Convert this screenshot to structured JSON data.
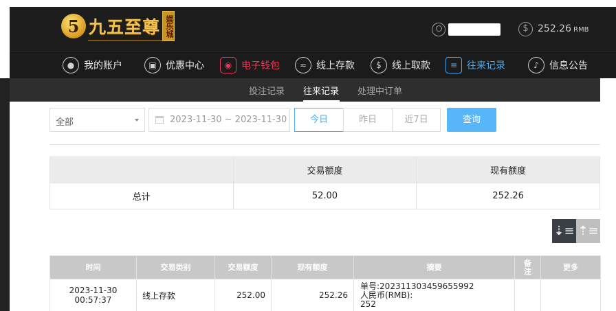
{
  "header": {
    "logo_mark": "5",
    "logo_text": "九五至尊",
    "logo_badge": "娱乐城",
    "balance_value": "252.26",
    "balance_unit": "RMB"
  },
  "nav": {
    "items": [
      {
        "label": "我的账户",
        "icon": "user-icon"
      },
      {
        "label": "优惠中心",
        "icon": "gift-icon"
      },
      {
        "label": "电子钱包",
        "icon": "wallet-icon"
      },
      {
        "label": "线上存款",
        "icon": "deposit-icon"
      },
      {
        "label": "线上取款",
        "icon": "withdraw-icon"
      },
      {
        "label": "往来记录",
        "icon": "records-icon"
      },
      {
        "label": "信息公告",
        "icon": "bell-icon"
      }
    ]
  },
  "subtabs": {
    "items": [
      {
        "label": "投注记录"
      },
      {
        "label": "往来记录"
      },
      {
        "label": "处理中订单"
      }
    ],
    "active": "往来记录"
  },
  "filters": {
    "type_select": "全部",
    "date_range": "2023-11-30 ~ 2023-11-30",
    "quick_ranges": [
      "今日",
      "昨日",
      "近7日"
    ],
    "active_range": "今日",
    "query_label": "查询"
  },
  "summary": {
    "headers": [
      "",
      "交易额度",
      "现有额度"
    ],
    "row": {
      "label": "总计",
      "amount": "52.00",
      "balance": "252.26"
    }
  },
  "records": {
    "headers": [
      "时间",
      "交易类别",
      "交易额度",
      "现有额度",
      "摘要",
      "备注",
      "更多"
    ],
    "rows": [
      {
        "time": "2023-11-30 00:57:37",
        "type": "线上存款",
        "amount": "252.00",
        "balance": "252.26",
        "summary_line1": "单号:202311303459655992",
        "summary_line2": "人民币(RMB):",
        "summary_line3": "252",
        "remark": "",
        "more": ""
      }
    ]
  },
  "colors": {
    "accent_blue": "#4aa9ee",
    "accent_red": "#e8395a",
    "gold": "#f2c14e",
    "dark_bg": "#1d1d1d"
  }
}
